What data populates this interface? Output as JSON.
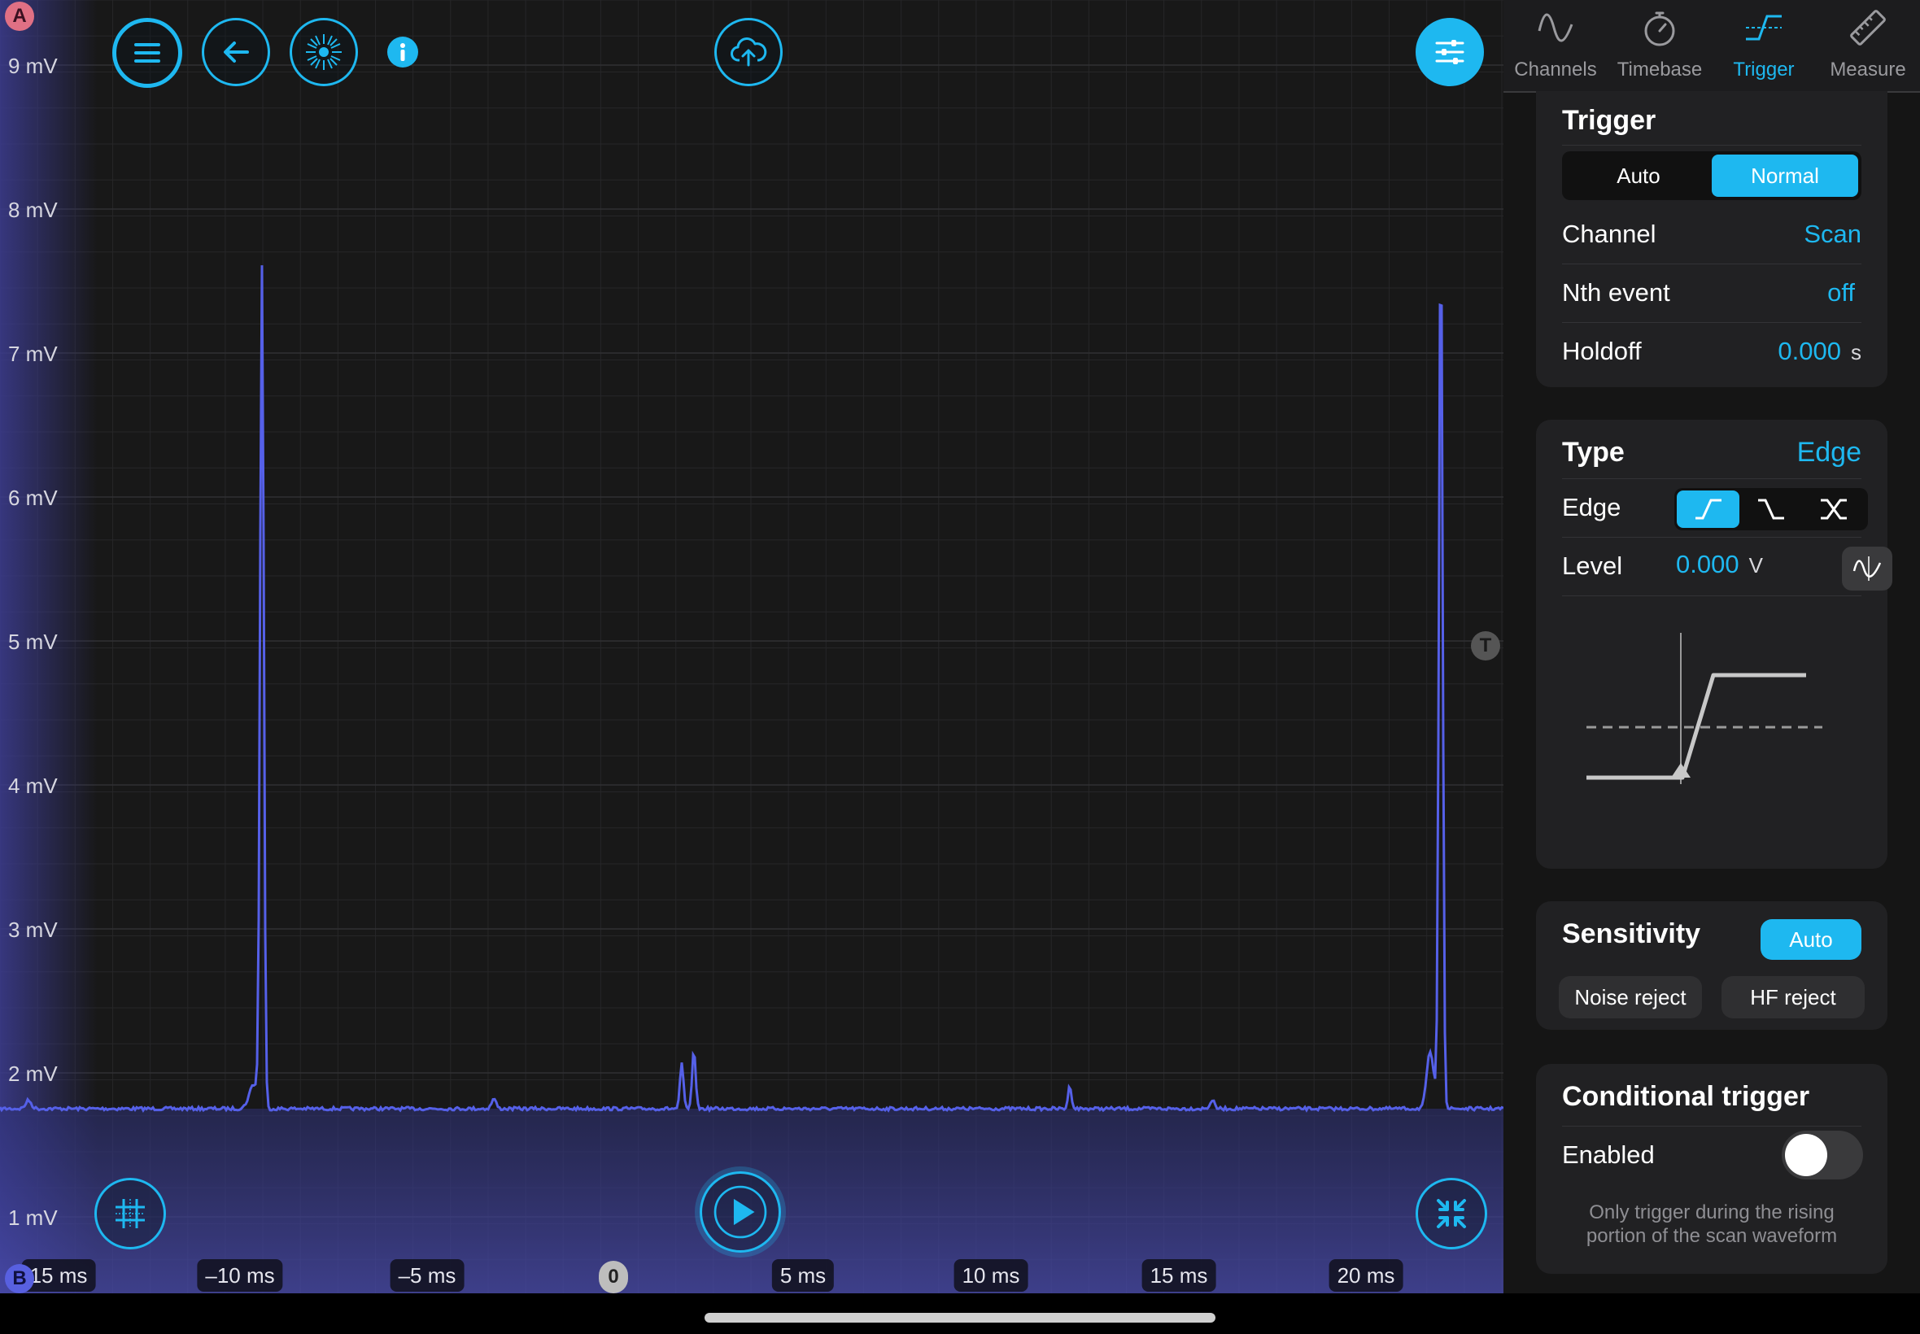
{
  "scope": {
    "y_axis": [
      "9 mV",
      "8 mV",
      "7 mV",
      "6 mV",
      "5 mV",
      "4 mV",
      "3 mV",
      "2 mV",
      "1 mV"
    ],
    "x_axis": [
      "15 ms",
      "–10 ms",
      "–5 ms",
      "5 ms",
      "10 ms",
      "15 ms",
      "20 ms"
    ],
    "markers": {
      "channel_a": "A",
      "channel_b": "B",
      "time_zero": "0",
      "trigger": "T"
    },
    "trace_color": "#5560e8",
    "accent_color": "#1eb8f0",
    "toolbar": {
      "menu_icon": "hamburger-icon",
      "back_icon": "arrow-left-icon",
      "sun_icon": "sunburst-icon",
      "info_icon": "info-icon",
      "upload_icon": "cloud-upload-icon",
      "settings_icon": "sliders-icon",
      "grid_icon": "grid-crosshair-icon",
      "play_icon": "play-icon",
      "collapse_icon": "arrows-collapse-icon"
    }
  },
  "tabs": [
    {
      "label": "Channels",
      "icon": "sine-wave-icon",
      "active": false
    },
    {
      "label": "Timebase",
      "icon": "stopwatch-icon",
      "active": false
    },
    {
      "label": "Trigger",
      "icon": "trigger-edge-icon",
      "active": true
    },
    {
      "label": "Measure",
      "icon": "ruler-icon",
      "active": false
    }
  ],
  "trigger": {
    "title": "Trigger",
    "mode_options": [
      "Auto",
      "Normal"
    ],
    "mode_selected": "Normal",
    "channel_label": "Channel",
    "channel_value": "Scan",
    "nth_label": "Nth event",
    "nth_value": "off",
    "holdoff_label": "Holdoff",
    "holdoff_value": "0.000",
    "holdoff_unit": "s"
  },
  "type": {
    "title": "Type",
    "value": "Edge",
    "edge_label": "Edge",
    "edge_options": [
      "rising-edge-icon",
      "falling-edge-icon",
      "either-edge-icon"
    ],
    "edge_selected": "rising-edge-icon",
    "level_label": "Level",
    "level_value": "0.000",
    "level_unit": "V"
  },
  "sensitivity": {
    "title": "Sensitivity",
    "auto_label": "Auto",
    "noise_reject_label": "Noise reject",
    "hf_reject_label": "HF reject"
  },
  "conditional": {
    "title": "Conditional trigger",
    "enabled_label": "Enabled",
    "enabled": false,
    "note": "Only trigger during the rising portion of the scan waveform"
  }
}
